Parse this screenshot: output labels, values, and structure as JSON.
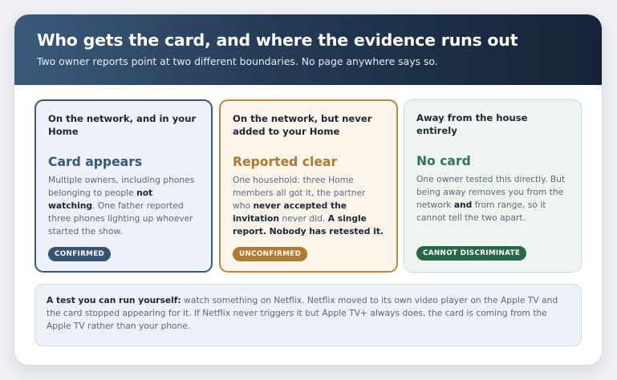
{
  "header": {
    "title": "Who gets the card, and where the evidence runs out",
    "subtitle": "Two owner reports point at two different boundaries. No page anywhere says so."
  },
  "panels": [
    {
      "title": "On the network, and in your Home",
      "heading": "Card appears",
      "body_1": "Multiple owners, including phones belonging to people ",
      "body_bold_1": "not watching",
      "body_2": ". One father reported three phones lighting up whoever started the show.",
      "badge": "CONFIRMED"
    },
    {
      "title": "On the network, but never added to your Home",
      "heading": "Reported clear",
      "body_1": "One household: three Home members all got it, the partner who ",
      "body_bold_1": "never accepted the invitation",
      "body_2": " never did. ",
      "body_bold_2": "A single report. Nobody has retested it.",
      "badge": "UNCONFIRMED"
    },
    {
      "title": "Away from the house entirely",
      "heading": "No card",
      "body_1": "One owner tested this directly. But being away removes you from the network ",
      "body_bold_1": "and",
      "body_2": " from range, so it cannot tell the two apart.",
      "badge": "CANNOT DISCRIMINATE"
    }
  ],
  "test": {
    "lead": "A test you can run yourself:",
    "text": " watch something on Netflix. Netflix moved to its own video player on the Apple TV and the card stopped appearing for it. If Netflix never triggers it but Apple TV+ always does, the card is coming from the Apple TV rather than your phone."
  },
  "colors": {
    "confirmed": "#355473",
    "unconfirmed": "#b07a32",
    "cannot_discriminate": "#286647"
  }
}
